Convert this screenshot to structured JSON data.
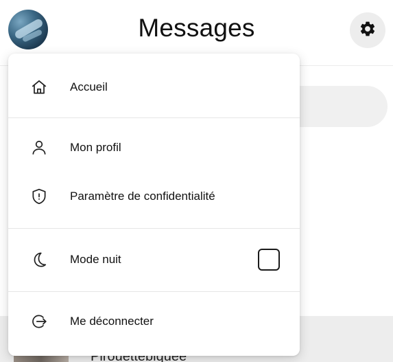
{
  "header": {
    "title": "Messages",
    "avatar_icon": "profile-photo",
    "settings_icon": "gear-icon"
  },
  "menu": {
    "items": [
      {
        "label": "Accueil",
        "icon": "home-icon"
      },
      {
        "label": "Mon profil",
        "icon": "user-icon"
      },
      {
        "label": "Paramètre de confidentialité",
        "icon": "shield-icon"
      },
      {
        "label": "Mode nuit",
        "icon": "moon-icon",
        "checked": false
      },
      {
        "label": "Me déconnecter",
        "icon": "logout-icon"
      }
    ]
  },
  "background": {
    "conversation_name": "Pirouettebiquée"
  },
  "colors": {
    "accent": "#111111",
    "menu_bg": "#ffffff",
    "divider": "#e6e6e6",
    "button_bg": "#ededed"
  }
}
